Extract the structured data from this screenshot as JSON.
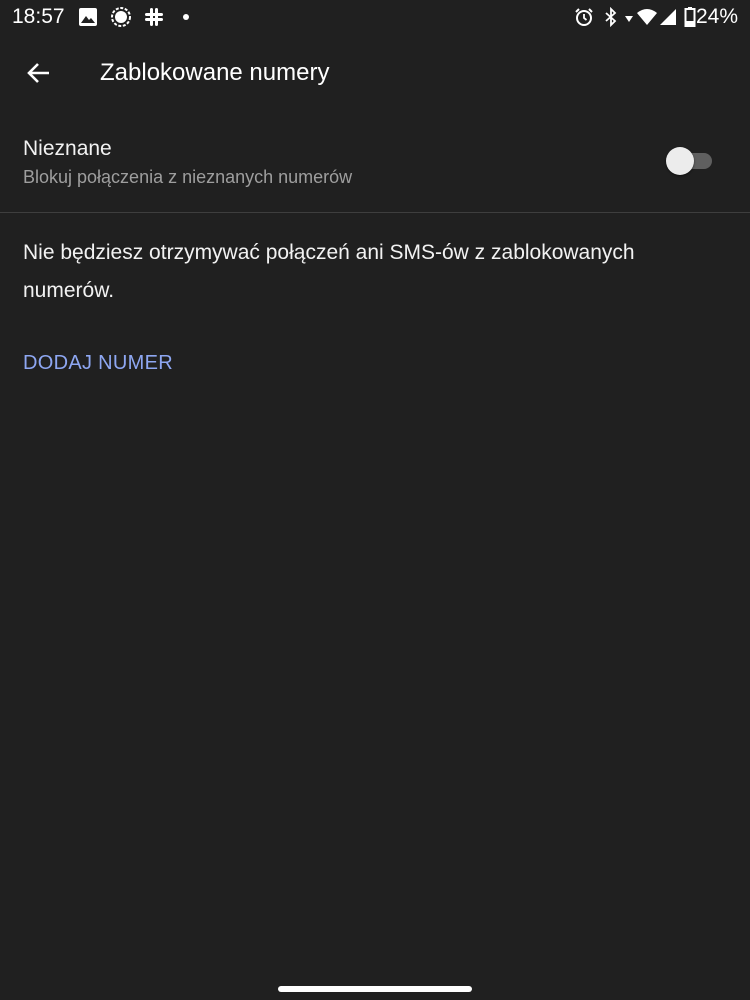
{
  "status_bar": {
    "time": "18:57",
    "battery": "24%",
    "left_icons": [
      "image-icon",
      "signal-app-icon",
      "slack-icon",
      "dot-icon"
    ],
    "right_icons": [
      "alarm-icon",
      "bluetooth-icon",
      "data-arrow-icon",
      "wifi-icon",
      "cell-signal-icon",
      "battery-icon"
    ]
  },
  "app_bar": {
    "title": "Zablokowane numery",
    "back_icon": "arrow-back-icon"
  },
  "unknown_setting": {
    "title": "Nieznane",
    "subtitle": "Blokuj połączenia z nieznanych numerów",
    "enabled": false
  },
  "info": {
    "text": "Nie będziesz otrzymywać połączeń ani SMS-ów z zablokowanych numerów."
  },
  "actions": {
    "add_number": "DODAJ NUMER"
  },
  "colors": {
    "background": "#202020",
    "accent": "#8ea7f2",
    "secondary_text": "#9e9e9e",
    "divider": "#3e3e3e"
  }
}
